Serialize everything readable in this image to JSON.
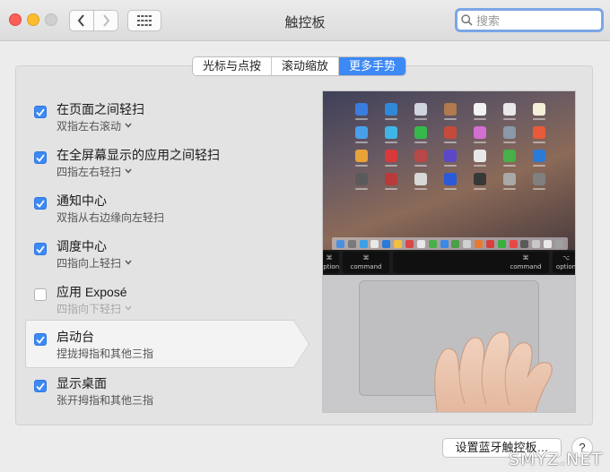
{
  "window": {
    "title": "触控板"
  },
  "search": {
    "placeholder": "搜索"
  },
  "tabs": [
    {
      "label": "光标与点按",
      "active": false
    },
    {
      "label": "滚动缩放",
      "active": false
    },
    {
      "label": "更多手势",
      "active": true
    }
  ],
  "gestures": [
    {
      "title": "在页面之间轻扫",
      "subtitle": "双指左右滚动",
      "checked": true,
      "has_dropdown": true,
      "disabled": false,
      "selected": false
    },
    {
      "title": "在全屏幕显示的应用之间轻扫",
      "subtitle": "四指左右轻扫",
      "checked": true,
      "has_dropdown": true,
      "disabled": false,
      "selected": false
    },
    {
      "title": "通知中心",
      "subtitle": "双指从右边缘向左轻扫",
      "checked": true,
      "has_dropdown": false,
      "disabled": false,
      "selected": false
    },
    {
      "title": "调度中心",
      "subtitle": "四指向上轻扫",
      "checked": true,
      "has_dropdown": true,
      "disabled": false,
      "selected": false
    },
    {
      "title": "应用 Exposé",
      "subtitle": "四指向下轻扫",
      "checked": false,
      "has_dropdown": true,
      "disabled": true,
      "selected": false
    },
    {
      "title": "启动台",
      "subtitle": "捏拢拇指和其他三指",
      "checked": true,
      "has_dropdown": false,
      "disabled": false,
      "selected": true
    },
    {
      "title": "显示桌面",
      "subtitle": "张开拇指和其他三指",
      "checked": true,
      "has_dropdown": false,
      "disabled": false,
      "selected": false
    }
  ],
  "preview": {
    "keys": [
      {
        "top": "⌘",
        "bottom": "option"
      },
      {
        "top": "⌘",
        "bottom": "command"
      },
      {
        "top": "⌘",
        "bottom": "command"
      },
      {
        "top": "⌥",
        "bottom": "option"
      }
    ]
  },
  "footer": {
    "bluetooth_button": "设置蓝牙触控板…",
    "help_button": "?"
  },
  "watermark": {
    "text": "SMYZ.NET"
  },
  "colors": {
    "accent": "#3d89f5",
    "panel": "#e3e3e3",
    "window": "#ececec"
  }
}
